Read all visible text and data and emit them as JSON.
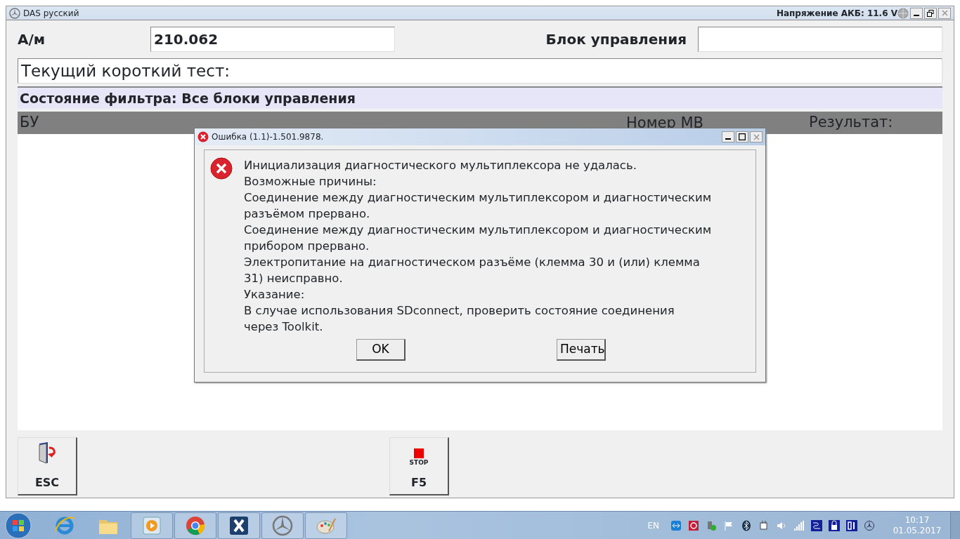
{
  "window": {
    "title": "DAS русский",
    "battery": "Напряжение АКБ: 11.6 V"
  },
  "vehicle": {
    "label": "А/м",
    "value": "210.062"
  },
  "control_unit": {
    "label": "Блок управления"
  },
  "current_test": "Текущий короткий тест:",
  "filter_status": "Состояние фильтра: Все блоки управления",
  "table": {
    "columns": [
      "БУ",
      "Номер MB",
      "Результат:"
    ]
  },
  "function_keys": [
    {
      "kind": "exit",
      "label": "ESC"
    },
    {
      "kind": "stop",
      "caption": "STOP",
      "label": "F5"
    }
  ],
  "dialog": {
    "title": "Ошибка  (1.1)-1.501.9878.",
    "lines": [
      "Инициализация диагностического мультиплексора не удалась.",
      "Возможные причины:",
      "Соединение между диагностическим мультиплексором и диагностическим",
      "разъёмом прервано.",
      "Соединение между диагностическим мультиплексором и диагностическим",
      "прибором прервано.",
      "Электропитание на диагностическом разъёме (клемма 30 и (или) клемма",
      "31) неисправно.",
      "Указание:",
      "В случае использования SDconnect, проверить состояние соединения",
      "через Toolkit."
    ],
    "buttons": [
      "OK",
      "Печать"
    ]
  },
  "taskbar": {
    "apps": [
      {
        "kind": "ie",
        "pinned": true
      },
      {
        "kind": "folder",
        "pinned": true
      },
      {
        "kind": "media",
        "pinned": false
      },
      {
        "kind": "chrome",
        "pinned": false
      },
      {
        "kind": "xapp",
        "pinned": false
      },
      {
        "kind": "star",
        "pinned": false
      },
      {
        "kind": "paint",
        "pinned": false
      }
    ],
    "language": "EN",
    "time": "10:17",
    "date": "01.05.2017"
  }
}
